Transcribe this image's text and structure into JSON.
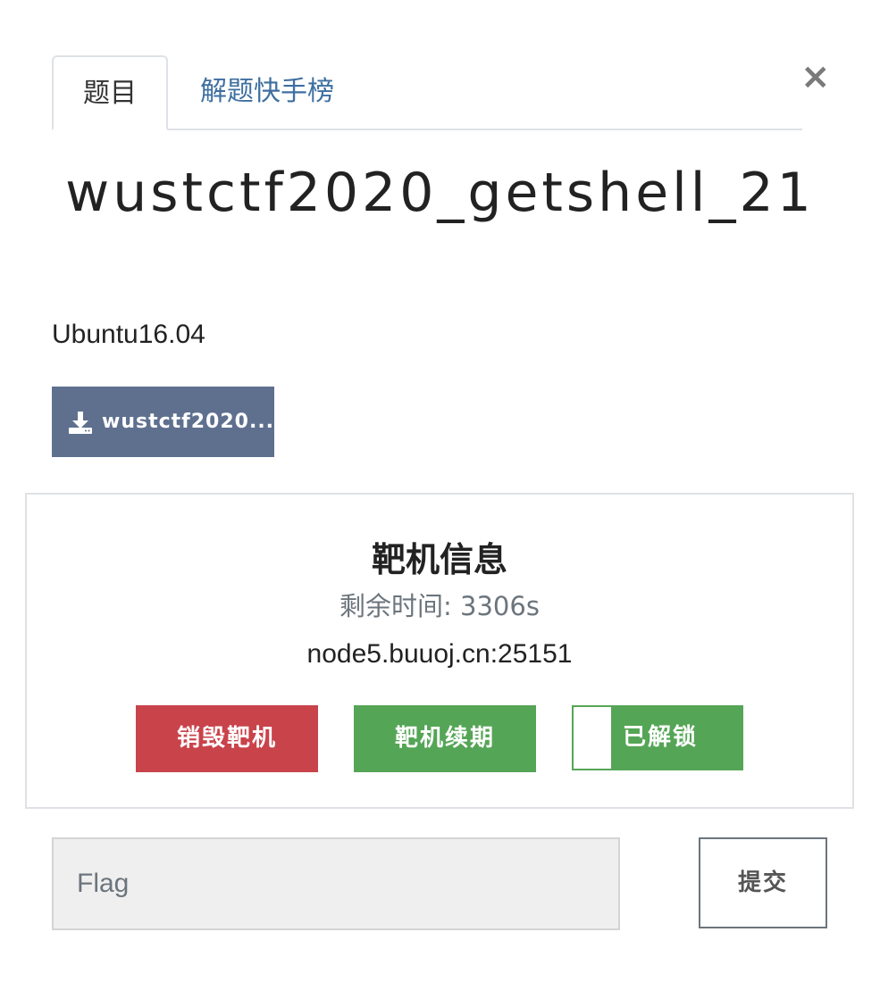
{
  "tabs": [
    {
      "label": "题目"
    },
    {
      "label": "解题快手榜"
    }
  ],
  "close_glyph": "×",
  "challenge": {
    "title": "wustctf2020_getshell_21",
    "description": "Ubuntu16.04",
    "download_label": "wustctf2020...",
    "download_icon": "download-icon"
  },
  "target": {
    "heading": "靶机信息",
    "remaining_label": "剩余时间:",
    "remaining_value": "3306s",
    "address": "node5.buuoj.cn:25151",
    "buttons": {
      "destroy": "销毁靶机",
      "renew": "靶机续期",
      "unlocked": "已解锁"
    }
  },
  "flag": {
    "placeholder": "Flag",
    "value": "",
    "submit_label": "提交"
  },
  "colors": {
    "tab_link": "#3e6fa0",
    "download_bg": "#5f708f",
    "destroy_bg": "#c9434b",
    "renew_bg": "#55a556",
    "muted_text": "#6c757d"
  }
}
